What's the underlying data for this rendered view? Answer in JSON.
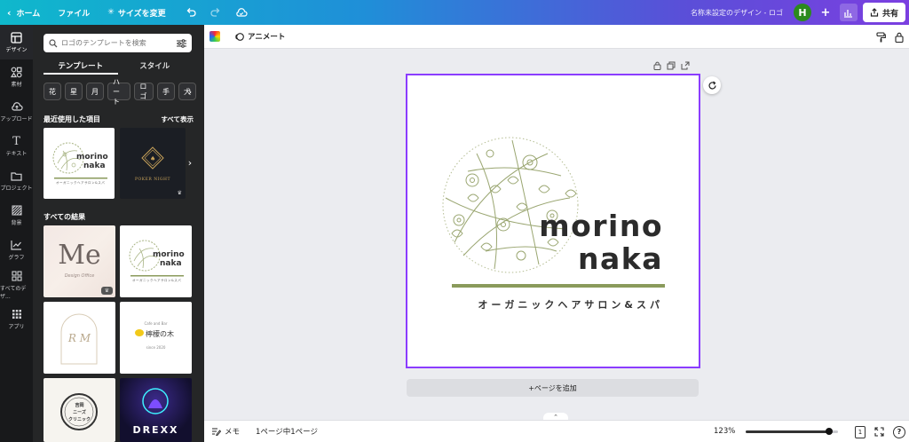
{
  "topbar": {
    "home": "ホーム",
    "file": "ファイル",
    "resize": "サイズを変更",
    "doc_title": "名称未設定のデザイン - ロゴ",
    "avatar_initial": "H",
    "share": "共有"
  },
  "rail": {
    "items": [
      {
        "label": "デザイン",
        "icon": "design-icon"
      },
      {
        "label": "素材",
        "icon": "elements-icon"
      },
      {
        "label": "アップロード",
        "icon": "upload-icon"
      },
      {
        "label": "テキスト",
        "icon": "text-icon"
      },
      {
        "label": "プロジェクト",
        "icon": "folder-icon"
      },
      {
        "label": "背景",
        "icon": "background-icon"
      },
      {
        "label": "グラフ",
        "icon": "chart-icon"
      },
      {
        "label": "すべてのデザ...",
        "icon": "all-designs-icon"
      },
      {
        "label": "アプリ",
        "icon": "apps-icon"
      }
    ]
  },
  "panel": {
    "search_placeholder": "ロゴのテンプレートを検索",
    "tabs": [
      "テンプレート",
      "スタイル"
    ],
    "chips": [
      "花",
      "星",
      "月",
      "ハート",
      "ロゴ",
      "手",
      "犬"
    ],
    "recent_heading": "最近使用した項目",
    "see_all": "すべて表示",
    "all_results_heading": "すべての結果",
    "thumbs": {
      "t1_line1": "morino",
      "t1_line2": "naka",
      "t1_tag": "オーガニックヘアサロン&スパ",
      "poker": "POKER NIGHT",
      "me": "Me",
      "me_sub": "Design Office",
      "rm": "R M",
      "lemon_top": "Cafe and Bar",
      "lemon": "檸檬の木",
      "lemon_sub": "since 2020",
      "clinic_line1": "吉岡",
      "clinic_line2": "ニーズ",
      "clinic_line3": "クリニック",
      "drexx": "DREXX"
    }
  },
  "toolbar": {
    "animate": "アニメート"
  },
  "canvas": {
    "brand_line1": "morino",
    "brand_line2": "naka",
    "tagline": "オーガニックヘアサロン&スパ",
    "add_page": "+ページを追加",
    "accent": "#8a9a5b",
    "selection": "#8b3dff"
  },
  "footer": {
    "notes": "メモ",
    "pages": "1ページ中1ページ",
    "zoom": "123%",
    "zoom_level": 0.9,
    "page_count": "1",
    "help": "?"
  }
}
